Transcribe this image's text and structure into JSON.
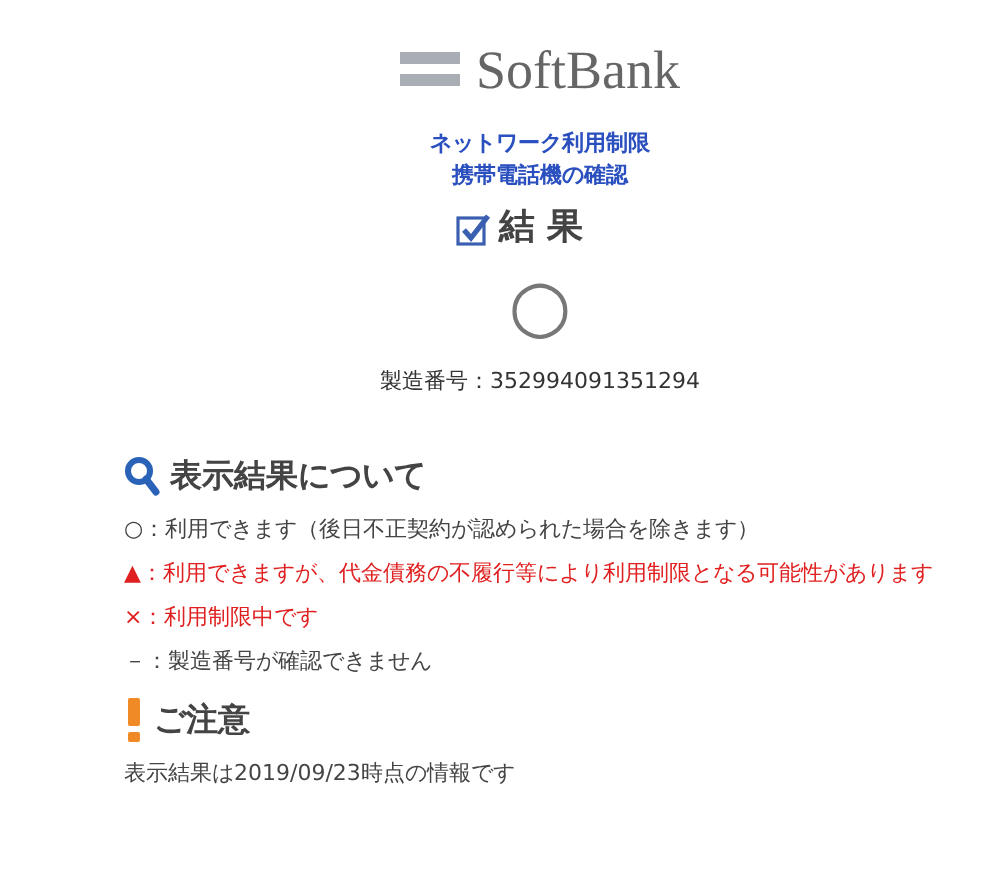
{
  "logo": {
    "text": "SoftBank"
  },
  "title_lines": [
    "ネットワーク利用制限",
    "携帯電話機の確認"
  ],
  "result_heading": "結 果",
  "result_mark": "○",
  "serial": "製造番号：352994091351294",
  "legend_heading": "表示結果について",
  "legend": [
    {
      "text": "○：利用できます（後日不正契約が認められた場合を除きます）",
      "color": "#444444"
    },
    {
      "text": "▲：利用できますが、代金債務の不履行等により利用制限となる可能性があります",
      "color": "#e02020"
    },
    {
      "text": "×：利用制限中です",
      "color": "#e02020"
    },
    {
      "text": "－：製造番号が確認できません",
      "color": "#444444"
    }
  ],
  "notice_heading": "ご注意",
  "notice": "表示結果は2019/09/23時点の情報です"
}
